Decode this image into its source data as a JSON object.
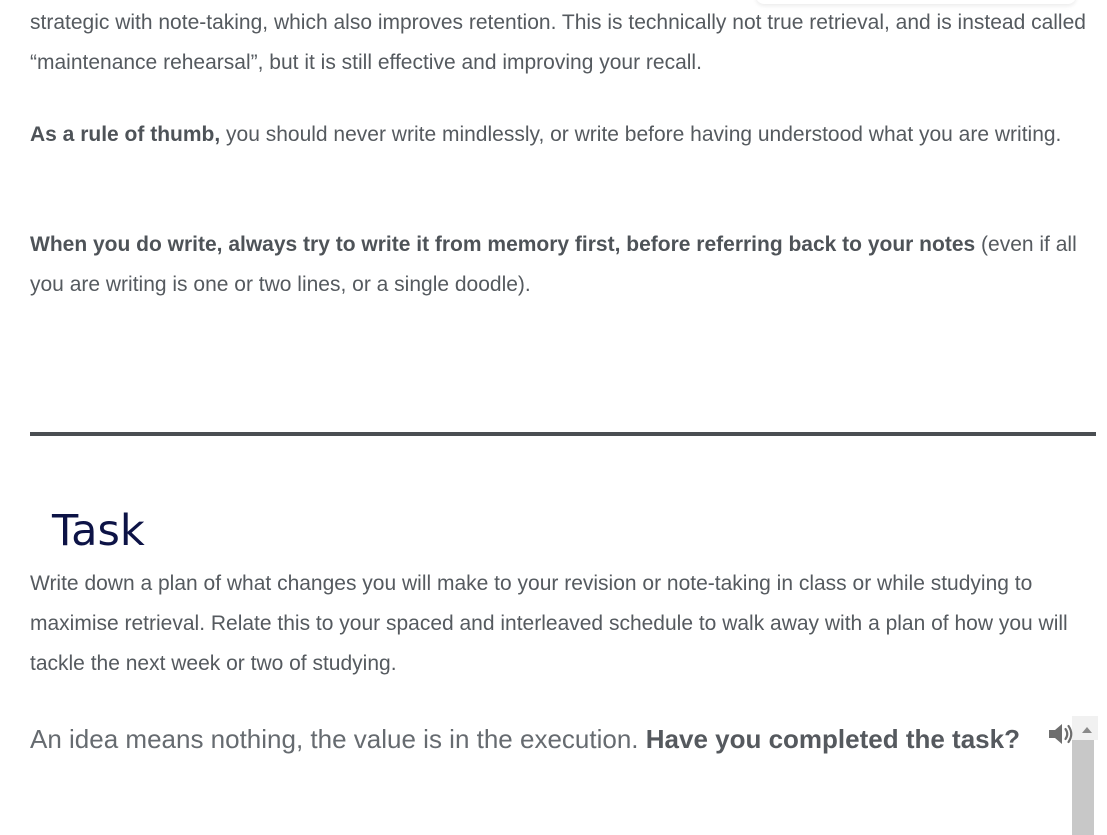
{
  "paragraphs": {
    "p1": "strategic with note-taking, which also improves retention. This is technically not true retrieval, and is instead called “maintenance rehearsal”, but it is still effective and improving your recall.",
    "p2_bold": "As a rule of thumb,",
    "p2_rest": " you should never write mindlessly, or write before having understood what you are writing.",
    "p3_bold": "When you do write, always try to write it from memory first, before referring back to your notes",
    "p3_rest": " (even if all you are writing is one or two lines, or a single doodle)."
  },
  "task": {
    "heading": "Task",
    "text": "Write down a plan of what changes you will make to your revision or note-taking in class or while studying to maximise retrieval. Relate this to your spaced and interleaved schedule to walk away with a plan of how you will tackle the next week or two of studying.",
    "question_plain": "An idea means nothing, the value is in the execution. ",
    "question_bold": "Have you completed the task?"
  },
  "widgets": {
    "audio_icon": "speaker-icon",
    "scroll_icon": "scroll-up-arrow-icon"
  }
}
